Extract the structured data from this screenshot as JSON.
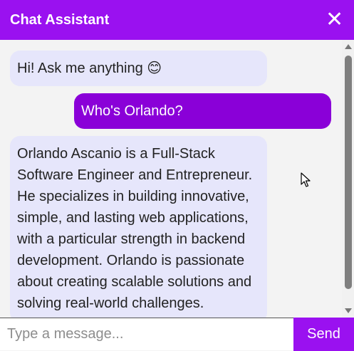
{
  "header": {
    "title": "Chat Assistant",
    "close_icon": "close-icon",
    "close_glyph": "✕"
  },
  "messages": [
    {
      "role": "bot",
      "text": "Hi! Ask me anything 😊"
    },
    {
      "role": "user",
      "text": "Who's Orlando?"
    },
    {
      "role": "bot",
      "text": "Orlando Ascanio is a Full-Stack Software Engineer and Entrepreneur. He specializes in building innovative, simple, and lasting web applications, with a particular strength in backend development. Orlando is passionate about creating scalable solutions and solving real-world challenges."
    }
  ],
  "composer": {
    "placeholder": "Type a message...",
    "value": "",
    "send_label": "Send"
  },
  "colors": {
    "accent": "#9a11f0",
    "user_bubble": "#8a00d8",
    "bot_bubble": "#e6e6fb",
    "background": "#f3f3f3"
  }
}
